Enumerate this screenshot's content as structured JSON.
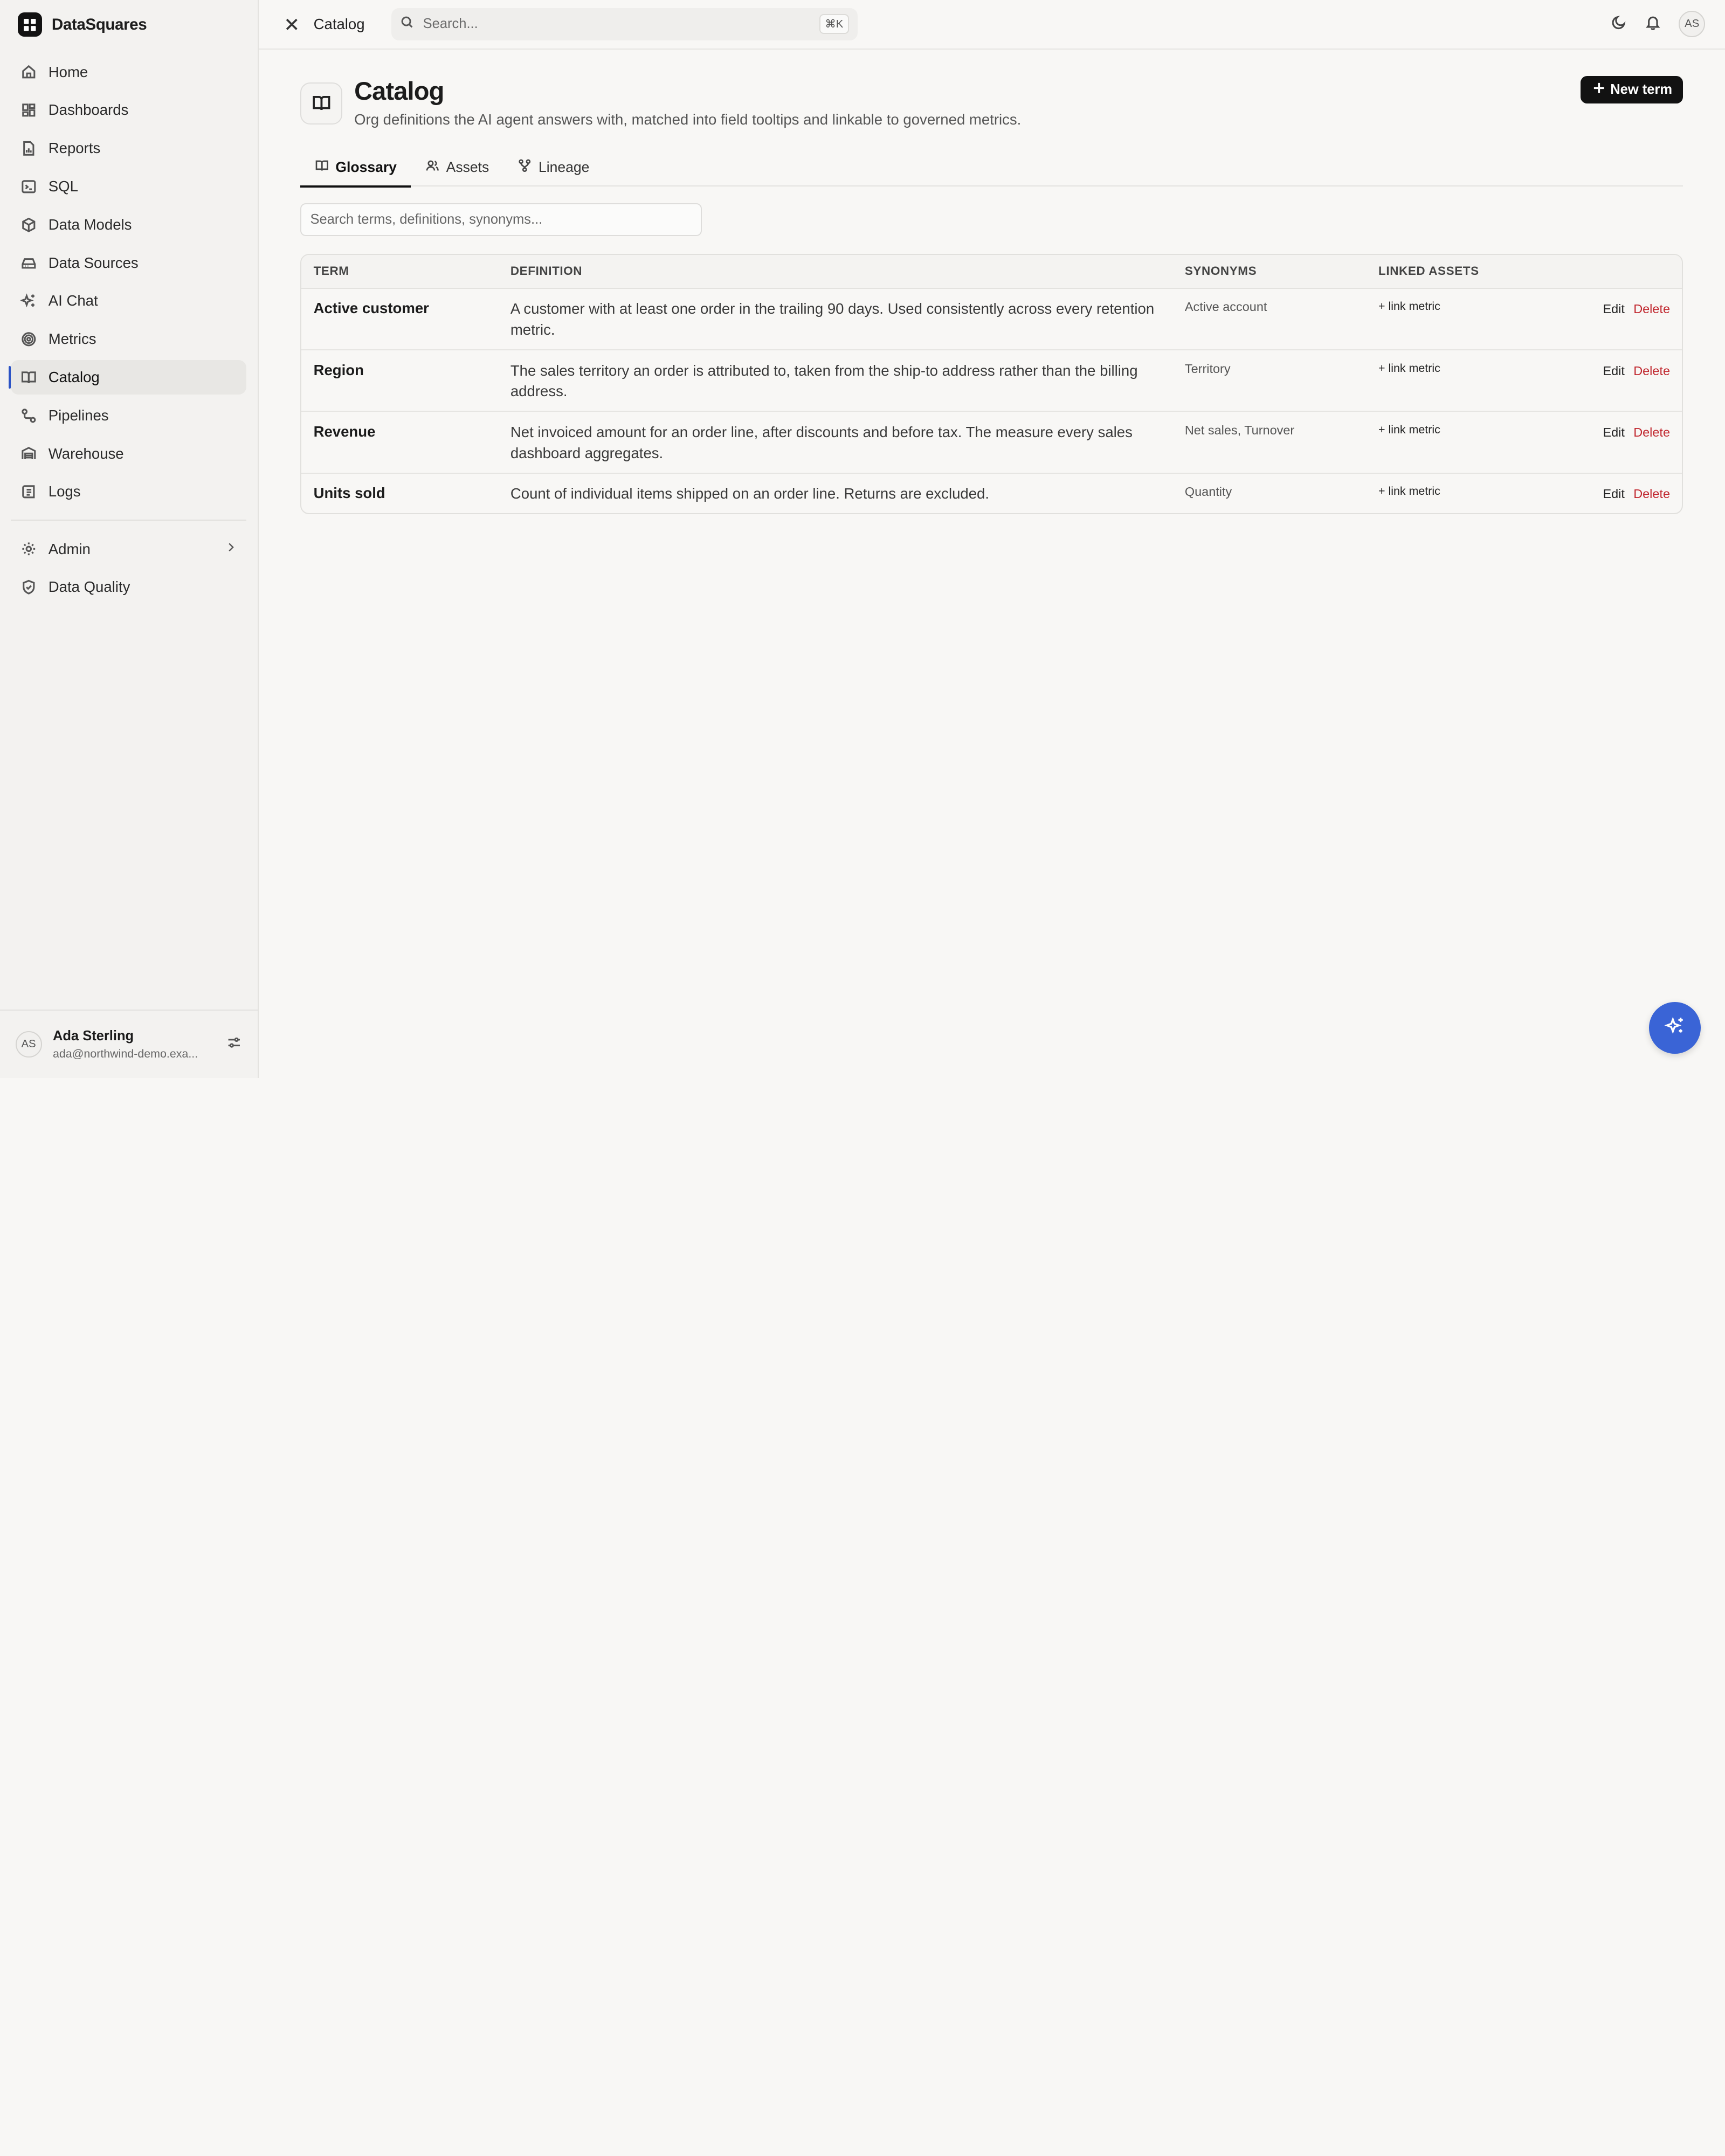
{
  "brand": {
    "name": "DataSquares"
  },
  "sidebar": {
    "items": [
      {
        "label": "Home",
        "icon": "home-icon"
      },
      {
        "label": "Dashboards",
        "icon": "dashboard-icon"
      },
      {
        "label": "Reports",
        "icon": "report-icon"
      },
      {
        "label": "SQL",
        "icon": "terminal-icon"
      },
      {
        "label": "Data Models",
        "icon": "cube-icon"
      },
      {
        "label": "Data Sources",
        "icon": "database-icon"
      },
      {
        "label": "AI Chat",
        "icon": "sparkle-icon"
      },
      {
        "label": "Metrics",
        "icon": "target-icon"
      },
      {
        "label": "Catalog",
        "icon": "book-icon",
        "active": true
      },
      {
        "label": "Pipelines",
        "icon": "pipeline-icon"
      },
      {
        "label": "Warehouse",
        "icon": "warehouse-icon"
      },
      {
        "label": "Logs",
        "icon": "logs-icon"
      }
    ],
    "secondary": [
      {
        "label": "Admin",
        "icon": "gear-icon"
      },
      {
        "label": "Data Quality",
        "icon": "shield-icon"
      }
    ],
    "user": {
      "initials": "AS",
      "name": "Ada Sterling",
      "email": "ada@northwind-demo.exa..."
    }
  },
  "topbar": {
    "crumb": "Catalog",
    "search_placeholder": "Search...",
    "search_shortcut": "⌘K",
    "avatar_initials": "AS"
  },
  "page": {
    "title": "Catalog",
    "subtitle": "Org definitions the AI agent answers with, matched into field tooltips and linkable to governed metrics.",
    "new_button": "New term",
    "tabs": [
      "Glossary",
      "Assets",
      "Lineage"
    ],
    "filter_placeholder": "Search terms, definitions, synonyms..."
  },
  "table": {
    "headers": [
      "TERM",
      "DEFINITION",
      "SYNONYMS",
      "LINKED ASSETS"
    ],
    "rows": [
      {
        "term": "Active customer",
        "definition": "A customer with at least one order in the trailing 90 days. Used consistently across every retention metric.",
        "synonyms": "Active account",
        "link": "+ link metric",
        "edit": "Edit",
        "delete": "Delete"
      },
      {
        "term": "Region",
        "definition": "The sales territory an order is attributed to, taken from the ship-to address rather than the billing address.",
        "synonyms": "Territory",
        "link": "+ link metric",
        "edit": "Edit",
        "delete": "Delete"
      },
      {
        "term": "Revenue",
        "definition": "Net invoiced amount for an order line, after discounts and before tax. The measure every sales dashboard aggregates.",
        "synonyms": "Net sales, Turnover",
        "link": "+ link metric",
        "edit": "Edit",
        "delete": "Delete"
      },
      {
        "term": "Units sold",
        "definition": "Count of individual items shipped on an order line. Returns are excluded.",
        "synonyms": "Quantity",
        "link": "+ link metric",
        "edit": "Edit",
        "delete": "Delete"
      }
    ]
  },
  "colors": {
    "accent": "#3a64d6",
    "danger": "#c0262d",
    "primary_button": "#121212"
  }
}
